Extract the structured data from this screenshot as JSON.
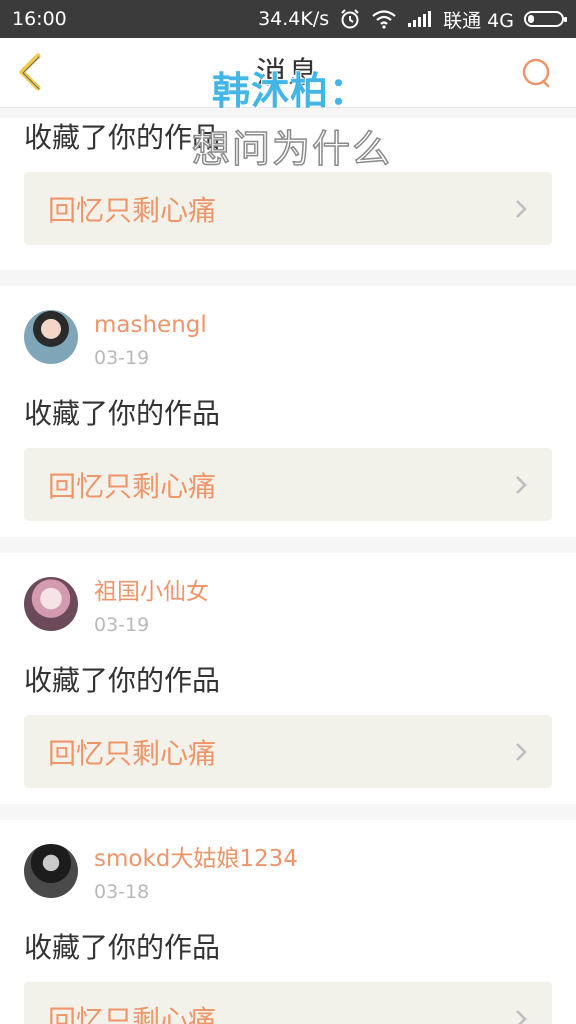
{
  "status_bar": {
    "time": "16:00",
    "speed": "34.4K/s",
    "carrier": "联通 4G"
  },
  "header": {
    "title": "消息",
    "overlay_name": "韩沐柏：",
    "overlay_text": "想问为什么"
  },
  "feed": {
    "items": [
      {
        "action": "收藏了你的作品",
        "work_title": "回忆只剩心痛"
      },
      {
        "username": "mashengl",
        "date": "03-19",
        "action": "收藏了你的作品",
        "work_title": "回忆只剩心痛"
      },
      {
        "username": "祖国小仙女",
        "date": "03-19",
        "action": "收藏了你的作品",
        "work_title": "回忆只剩心痛"
      },
      {
        "username": "smokd大姑娘1234",
        "date": "03-18",
        "action": "收藏了你的作品",
        "work_title": "回忆只剩心痛"
      }
    ]
  },
  "colors": {
    "accent": "#f0956a",
    "overlay_blue": "#42b6e6",
    "card_bg": "#f3f2ea"
  },
  "icons": [
    "alarm-icon",
    "wifi-icon",
    "signal-icon",
    "battery-icon",
    "back-icon",
    "search-icon",
    "chevron-right-icon"
  ]
}
